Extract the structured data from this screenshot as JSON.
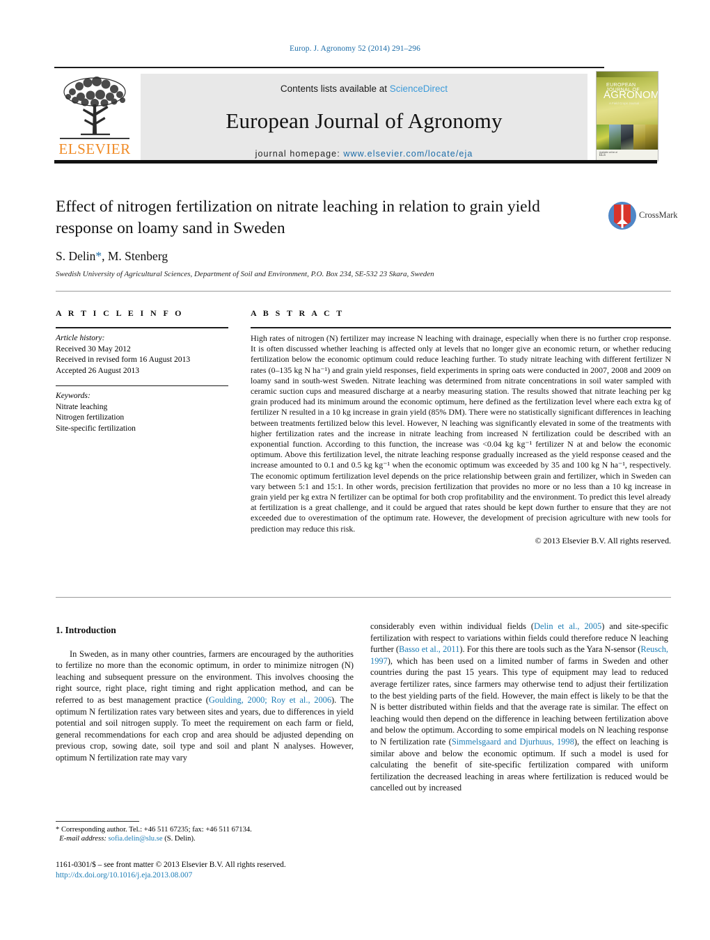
{
  "running_head": "Europ. J. Agronomy 52 (2014) 291–296",
  "publisher": {
    "name": "ELSEVIER",
    "logo_icon": "elsevier-tree-logo"
  },
  "journal_header": {
    "contents_prefix": "Contents lists available at",
    "contents_link": "ScienceDirect",
    "journal_title": "European Journal of Agronomy",
    "homepage_prefix": "journal homepage:",
    "homepage_url": "www.elsevier.com/locate/eja",
    "cover": {
      "kicker": "EUROPEAN JOURNAL OF",
      "title": "AGRONOMY",
      "subtitle": "A Field Crops Journal"
    }
  },
  "article": {
    "title": "Effect of nitrogen fertilization on nitrate leaching in relation to grain yield response on loamy sand in Sweden",
    "authors": "S. Delin",
    "authors_rest": ", M. Stenberg",
    "author_star": "*",
    "affiliation": "Swedish University of Agricultural Sciences, Department of Soil and Environment, P.O. Box 234, SE-532 23 Skara, Sweden",
    "crossmark_label": "CrossMark"
  },
  "article_info": {
    "heading": "A R T I C L E   I N F O",
    "history_label": "Article history:",
    "history": [
      "Received 30 May 2012",
      "Received in revised form 16 August 2013",
      "Accepted 26 August 2013"
    ],
    "keywords_label": "Keywords:",
    "keywords": [
      "Nitrate leaching",
      "Nitrogen fertilization",
      "Site-specific fertilization"
    ]
  },
  "abstract": {
    "heading": "A B S T R A C T",
    "text": "High rates of nitrogen (N) fertilizer may increase N leaching with drainage, especially when there is no further crop response. It is often discussed whether leaching is affected only at levels that no longer give an economic return, or whether reducing fertilization below the economic optimum could reduce leaching further. To study nitrate leaching with different fertilizer N rates (0–135 kg N ha⁻¹) and grain yield responses, field experiments in spring oats were conducted in 2007, 2008 and 2009 on loamy sand in south-west Sweden. Nitrate leaching was determined from nitrate concentrations in soil water sampled with ceramic suction cups and measured discharge at a nearby measuring station. The results showed that nitrate leaching per kg grain produced had its minimum around the economic optimum, here defined as the fertilization level where each extra kg of fertilizer N resulted in a 10 kg increase in grain yield (85% DM). There were no statistically significant differences in leaching between treatments fertilized below this level. However, N leaching was significantly elevated in some of the treatments with higher fertilization rates and the increase in nitrate leaching from increased N fertilization could be described with an exponential function. According to this function, the increase was <0.04 kg kg⁻¹ fertilizer N at and below the economic optimum. Above this fertilization level, the nitrate leaching response gradually increased as the yield response ceased and the increase amounted to 0.1 and 0.5 kg kg⁻¹ when the economic optimum was exceeded by 35 and 100 kg N ha⁻¹, respectively. The economic optimum fertilization level depends on the price relationship between grain and fertilizer, which in Sweden can vary between 5:1 and 15:1. In other words, precision fertilization that provides no more or no less than a 10 kg increase in grain yield per kg extra N fertilizer can be optimal for both crop profitability and the environment. To predict this level already at fertilization is a great challenge, and it could be argued that rates should be kept down further to ensure that they are not exceeded due to overestimation of the optimum rate. However, the development of precision agriculture with new tools for prediction may reduce this risk.",
    "copyright": "© 2013 Elsevier B.V. All rights reserved."
  },
  "body": {
    "section_heading": "1.  Introduction",
    "left_para_1": "In Sweden, as in many other countries, farmers are encouraged by the authorities to fertilize no more than the economic optimum, in order to minimize nitrogen (N) leaching and subsequent pressure on the environment. This involves choosing the right source, right place, right timing and right application method, and can be referred to as best management practice (",
    "left_cite_1": "Goulding, 2000; Roy et al., 2006",
    "left_para_1b": "). The optimum N fertilization rates vary between sites and years, due to differences in yield potential and soil nitrogen supply. To meet the requirement on each farm or field, general recommendations for each crop and area should be adjusted depending on previous crop, sowing date, soil type and soil and plant N analyses. However, optimum N fertilization rate may vary",
    "right_para_1": "considerably even within individual fields (",
    "right_cite_1": "Delin et al., 2005",
    "right_para_1b": ") and site-specific fertilization with respect to variations within fields could therefore reduce N leaching further (",
    "right_cite_2": "Basso et al., 2011",
    "right_para_1c": "). For this there are tools such as the Yara N-sensor (",
    "right_cite_3": "Reusch, 1997",
    "right_para_1d": "), which has been used on a limited number of farms in Sweden and other countries during the past 15 years. This type of equipment may lead to reduced average fertilizer rates, since farmers may otherwise tend to adjust their fertilization to the best yielding parts of the field. However, the main effect is likely to be that the N is better distributed within fields and that the average rate is similar. The effect on leaching would then depend on the difference in leaching between fertilization above and below the optimum. According to some empirical models on N leaching response to N fertilization rate (",
    "right_cite_4": "Simmelsgaard and Djurhuus, 1998",
    "right_para_1e": "), the effect on leaching is similar above and below the economic optimum. If such a model is used for calculating the benefit of site-specific fertilization compared with uniform fertilization the decreased leaching in areas where fertilization is reduced would be cancelled out by increased"
  },
  "footnotes": {
    "corresponding": "* Corresponding author. Tel.: +46 511 67235; fax: +46 511 67134.",
    "email_label": "E-mail address:",
    "email": "sofia.delin@slu.se",
    "email_suffix": "(S. Delin).",
    "front_matter": "1161-0301/$ – see front matter © 2013 Elsevier B.V. All rights reserved.",
    "doi": "http://dx.doi.org/10.1016/j.eja.2013.08.007"
  },
  "colors": {
    "link_blue": "#1b7cb5",
    "sciencedirect_blue": "#3b9ad9",
    "elsevier_orange": "#f08a24",
    "crossmark_red": "#d9342b",
    "crossmark_blue": "#4f86c6"
  }
}
